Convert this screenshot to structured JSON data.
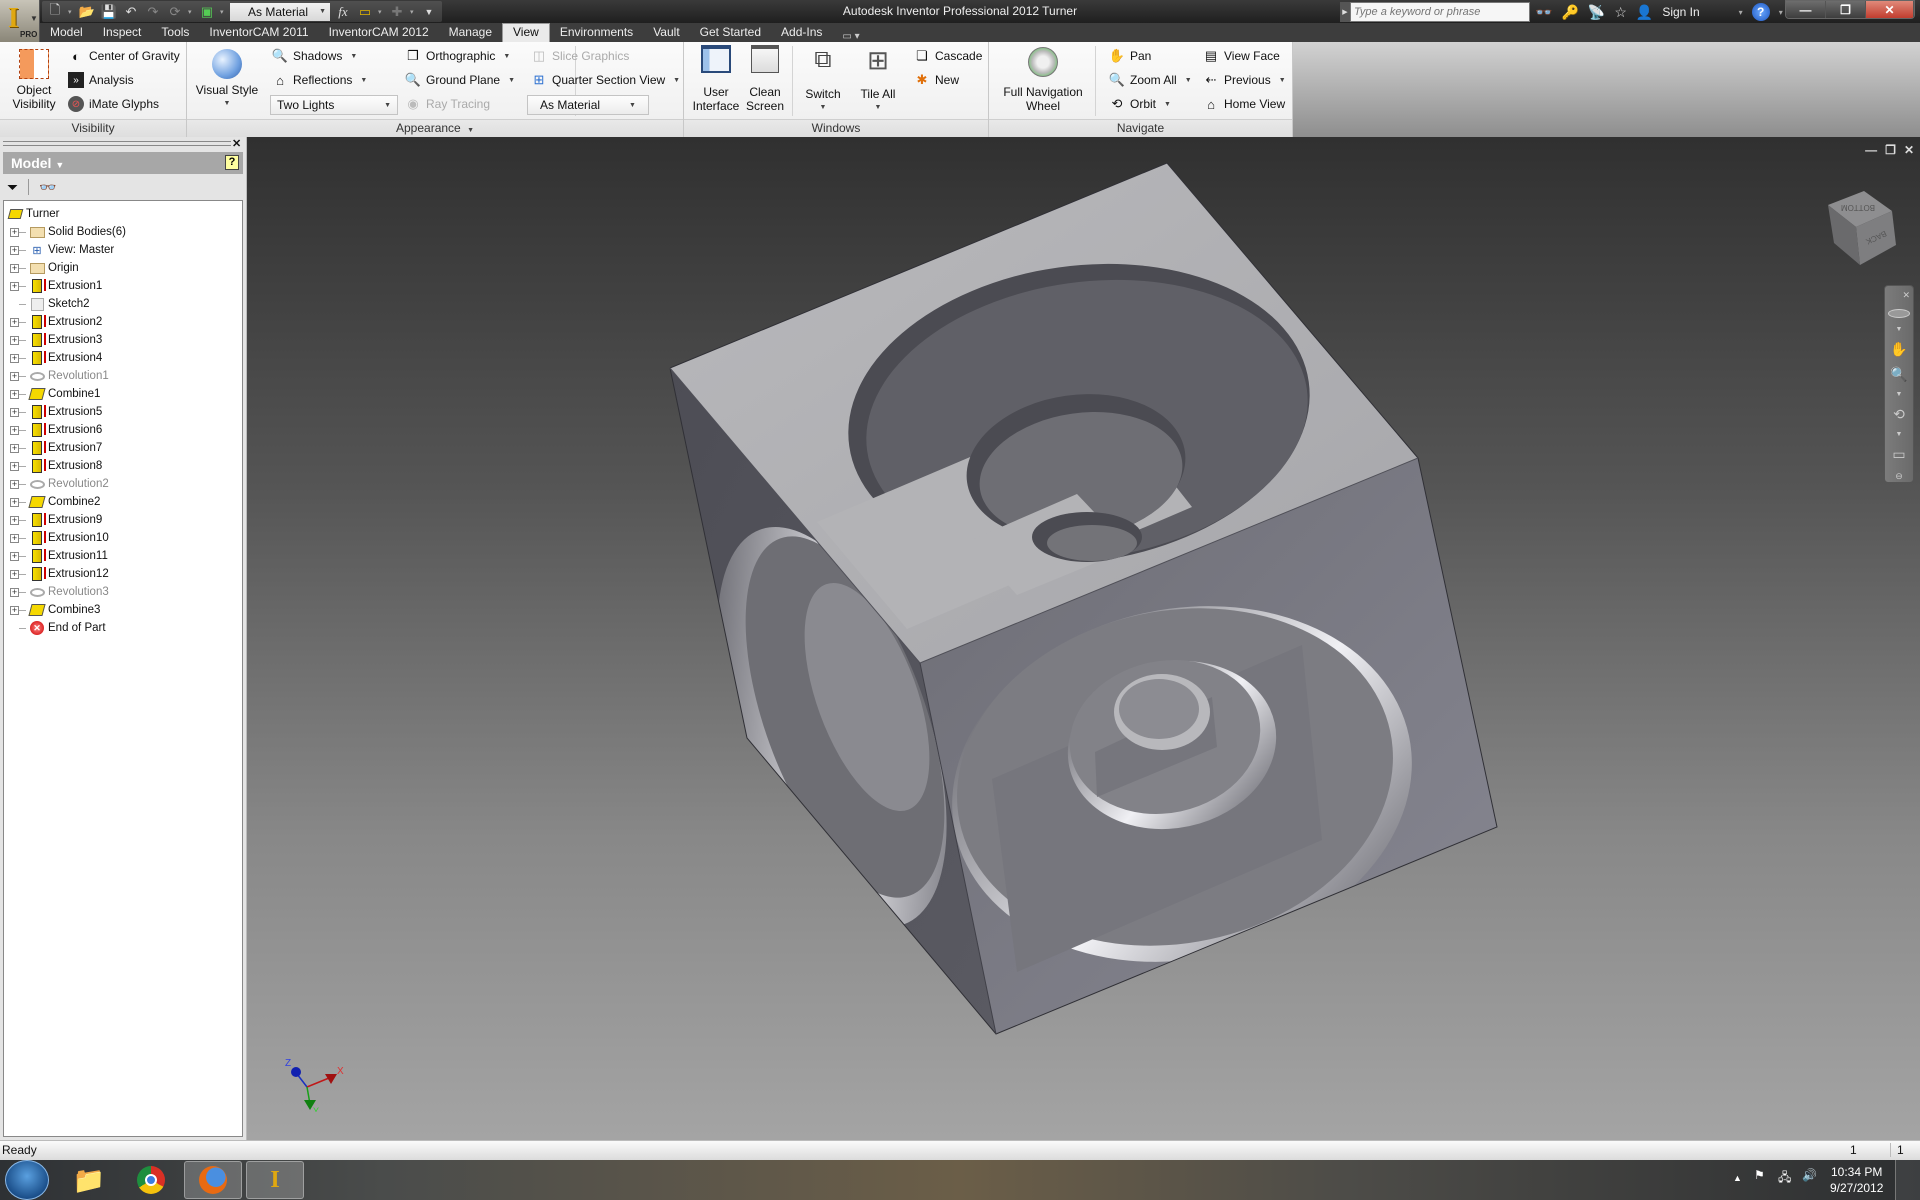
{
  "window": {
    "title": "Autodesk Inventor Professional 2012    Turner",
    "app_badge": "PRO"
  },
  "quick_access": {
    "material_value": "As Material"
  },
  "infocenter": {
    "search_placeholder": "Type a keyword or phrase",
    "sign_in": "Sign In",
    "help": "?"
  },
  "tabs": [
    {
      "label": "Model"
    },
    {
      "label": "Inspect"
    },
    {
      "label": "Tools"
    },
    {
      "label": "InventorCAM 2011"
    },
    {
      "label": "InventorCAM 2012"
    },
    {
      "label": "Manage"
    },
    {
      "label": "View",
      "active": true
    },
    {
      "label": "Environments"
    },
    {
      "label": "Vault"
    },
    {
      "label": "Get Started"
    },
    {
      "label": "Add-Ins"
    }
  ],
  "ribbon": {
    "visibility": {
      "label": "Visibility",
      "object_visibility": [
        "Object",
        "Visibility"
      ],
      "center_of_gravity": "Center of Gravity",
      "analysis": "Analysis",
      "imate_glyphs": "iMate Glyphs"
    },
    "appearance": {
      "label": "Appearance",
      "visual_style": "Visual Style",
      "shadows": "Shadows",
      "reflections": "Reflections",
      "lighting_value": "Two Lights",
      "orthographic": "Orthographic",
      "ground_plane": "Ground Plane",
      "ray_tracing": "Ray Tracing",
      "slice_graphics": "Slice Graphics",
      "quarter_section_view": "Quarter Section View",
      "appearance_value": "As Material"
    },
    "windows": {
      "label": "Windows",
      "user_interface": [
        "User",
        "Interface"
      ],
      "clean_screen": [
        "Clean",
        "Screen"
      ],
      "switch": "Switch",
      "tile_all": "Tile All",
      "cascade": "Cascade",
      "new": "New"
    },
    "navigate": {
      "label": "Navigate",
      "full_navigation_wheel": [
        "Full Navigation",
        "Wheel"
      ],
      "pan": "Pan",
      "zoom_all": "Zoom All",
      "orbit": "Orbit",
      "view_face": "View Face",
      "previous": "Previous",
      "home_view": "Home View"
    }
  },
  "browser": {
    "header": "Model",
    "root": "Turner",
    "nodes": [
      {
        "label": "Solid Bodies(6)",
        "icon": "folder",
        "expandable": true
      },
      {
        "label": "View: Master",
        "icon": "view",
        "expandable": true
      },
      {
        "label": "Origin",
        "icon": "folder",
        "expandable": true
      },
      {
        "label": "Extrusion1",
        "icon": "extrusion",
        "expandable": true
      },
      {
        "label": "Sketch2",
        "icon": "sketch",
        "expandable": false
      },
      {
        "label": "Extrusion2",
        "icon": "extrusion",
        "expandable": true
      },
      {
        "label": "Extrusion3",
        "icon": "extrusion",
        "expandable": true
      },
      {
        "label": "Extrusion4",
        "icon": "extrusion",
        "expandable": true
      },
      {
        "label": "Revolution1",
        "icon": "revolution",
        "expandable": true,
        "suppressed": true
      },
      {
        "label": "Combine1",
        "icon": "combine",
        "expandable": true
      },
      {
        "label": "Extrusion5",
        "icon": "extrusion",
        "expandable": true
      },
      {
        "label": "Extrusion6",
        "icon": "extrusion",
        "expandable": true
      },
      {
        "label": "Extrusion7",
        "icon": "extrusion",
        "expandable": true
      },
      {
        "label": "Extrusion8",
        "icon": "extrusion",
        "expandable": true
      },
      {
        "label": "Revolution2",
        "icon": "revolution",
        "expandable": true,
        "suppressed": true
      },
      {
        "label": "Combine2",
        "icon": "combine",
        "expandable": true
      },
      {
        "label": "Extrusion9",
        "icon": "extrusion",
        "expandable": true
      },
      {
        "label": "Extrusion10",
        "icon": "extrusion",
        "expandable": true
      },
      {
        "label": "Extrusion11",
        "icon": "extrusion",
        "expandable": true
      },
      {
        "label": "Extrusion12",
        "icon": "extrusion",
        "expandable": true
      },
      {
        "label": "Revolution3",
        "icon": "revolution",
        "expandable": true,
        "suppressed": true
      },
      {
        "label": "Combine3",
        "icon": "combine",
        "expandable": true
      },
      {
        "label": "End of Part",
        "icon": "end",
        "expandable": false
      }
    ]
  },
  "viewcube": {
    "top_face": "BOTTOM",
    "front_face": "BACK"
  },
  "triad": {
    "x": "X",
    "y": "Y",
    "z": "Z"
  },
  "status": {
    "text": "Ready",
    "count1": "1",
    "count2": "1"
  },
  "taskbar": {
    "time": "10:34 PM",
    "date": "9/27/2012"
  }
}
